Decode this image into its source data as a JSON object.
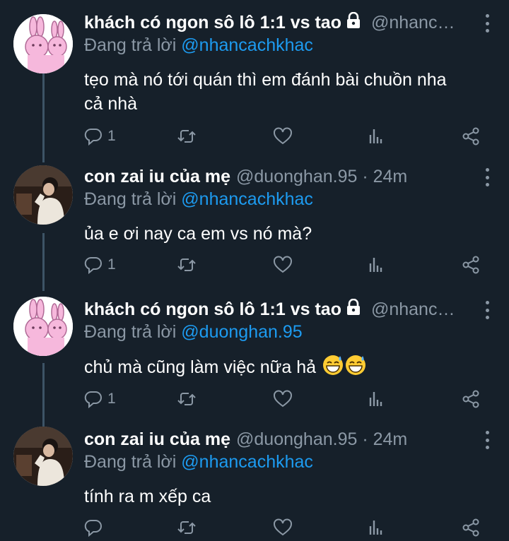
{
  "thread": [
    {
      "avatar": "pink-bunny-avatar",
      "name": "khách có ngon sô lô 1:1 vs tao",
      "locked": true,
      "handle": "@nhanc…",
      "reply_label": "Đang trả lời",
      "reply_to": "@nhancachkhac",
      "text_lines": [
        "tẹo mà nó tới quán thì em đánh bài chuồn nha",
        "cả nhà"
      ],
      "reply_count": "1"
    },
    {
      "avatar": "photo-avatar",
      "name": "con zai iu của mẹ",
      "handle": "@duonghan.95 · 24m",
      "reply_label": "Đang trả lời",
      "reply_to": "@nhancachkhac",
      "text_lines": [
        "ủa e ơi nay ca em vs nó mà?"
      ],
      "reply_count": "1"
    },
    {
      "avatar": "pink-bunny-avatar",
      "name": "khách có ngon sô lô 1:1 vs tao",
      "locked": true,
      "handle": "@nhanc…",
      "reply_label": "Đang trả lời",
      "reply_to": "@duonghan.95",
      "text_lines": [
        "chủ mà cũng làm việc nữa hả"
      ],
      "emojis": [
        "grinning-sweat-emoji",
        "grinning-sweat-emoji"
      ],
      "reply_count": "1"
    },
    {
      "avatar": "photo-avatar",
      "name": "con zai iu của mẹ",
      "handle": "@duonghan.95 · 24m",
      "reply_label": "Đang trả lời",
      "reply_to": "@nhancachkhac",
      "text_lines": [
        "tính ra m xếp ca"
      ],
      "reply_count": ""
    }
  ],
  "icons": {
    "reply": "reply-icon",
    "retweet": "retweet-icon",
    "like": "heart-icon",
    "views": "views-icon",
    "share": "share-icon",
    "more": "more-icon",
    "lock": "lock-icon"
  },
  "colors": {
    "background": "#16202a",
    "text": "#ffffff",
    "secondary": "#8b98a5",
    "mention": "#1d9bf0",
    "thread_line": "#3d5466"
  }
}
